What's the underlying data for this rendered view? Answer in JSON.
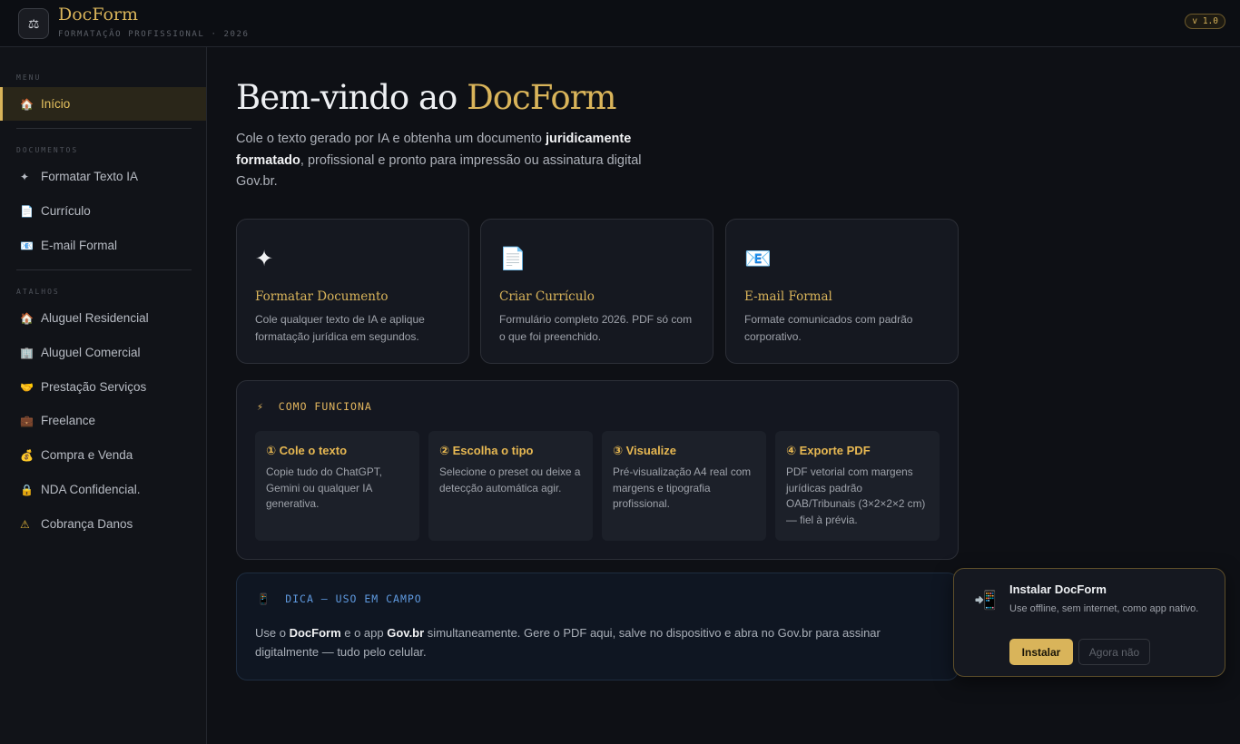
{
  "header": {
    "logo_icon": "scales-icon",
    "brand": "DocForm",
    "subtitle": "FORMATAÇÃO PROFISSIONAL · 2026",
    "version": "v 1.0",
    "accent_color": "#d9b45a"
  },
  "sidebar": {
    "menu_label": "MENU",
    "home": {
      "icon": "🏠",
      "label": "Início"
    },
    "documentos_label": "DOCUMENTOS",
    "documentos": [
      {
        "icon": "✦",
        "label": "Formatar Texto IA"
      },
      {
        "icon": "📄",
        "label": "Currículo"
      },
      {
        "icon": "📧",
        "label": "E-mail Formal"
      }
    ],
    "atalhos_label": "ATALHOS",
    "atalhos": [
      {
        "icon": "🏠",
        "label": "Aluguel Residencial"
      },
      {
        "icon": "🏢",
        "label": "Aluguel Comercial"
      },
      {
        "icon": "🤝",
        "label": "Prestação Serviços"
      },
      {
        "icon": "💼",
        "label": "Freelance"
      },
      {
        "icon": "💰",
        "label": "Compra e Venda"
      },
      {
        "icon": "🔒",
        "label": "NDA Confidencial."
      },
      {
        "icon": "⚠",
        "label": "Cobrança Danos"
      }
    ]
  },
  "main": {
    "title_prefix": "Bem-vindo ao ",
    "title_accent": "DocForm",
    "intro_1": "Cole o texto gerado por IA e obtenha um documento ",
    "intro_bold": "juridicamente formatado",
    "intro_2": ", profissional e pronto para impressão ou assinatura digital Gov.br.",
    "cards": [
      {
        "icon": "✦",
        "title": "Formatar Documento",
        "desc": "Cole qualquer texto de IA e aplique formatação jurídica em segundos."
      },
      {
        "icon": "📄",
        "title": "Criar Currículo",
        "desc": "Formulário completo 2026. PDF só com o que foi preenchido."
      },
      {
        "icon": "📧",
        "title": "E-mail Formal",
        "desc": "Formate comunicados com padrão corporativo."
      }
    ],
    "how": {
      "icon": "⚡",
      "label": "COMO FUNCIONA",
      "steps": [
        {
          "title": "① Cole o texto",
          "desc": "Copie tudo do ChatGPT, Gemini ou qualquer IA generativa."
        },
        {
          "title": "② Escolha o tipo",
          "desc": "Selecione o preset ou deixe a detecção automática agir."
        },
        {
          "title": "③ Visualize",
          "desc": "Pré-visualização A4 real com margens e tipografia profissional."
        },
        {
          "title": "④ Exporte PDF",
          "desc": "PDF vetorial com margens jurídicas padrão OAB/Tribunais (3×2×2×2 cm) — fiel à prévia."
        }
      ]
    },
    "tip": {
      "icon": "📱",
      "label": "DICA — USO EM CAMPO",
      "t1": "Use o ",
      "b1": "DocForm",
      "t2": " e o app ",
      "b2": "Gov.br",
      "t3": " simultaneamente. Gere o PDF aqui, salve no dispositivo e abra no Gov.br para assinar digitalmente — tudo pelo celular."
    }
  },
  "install": {
    "icon": "📲",
    "title": "Instalar DocForm",
    "desc": "Use offline, sem internet, como app nativo.",
    "install_label": "Instalar",
    "later_label": "Agora não"
  }
}
